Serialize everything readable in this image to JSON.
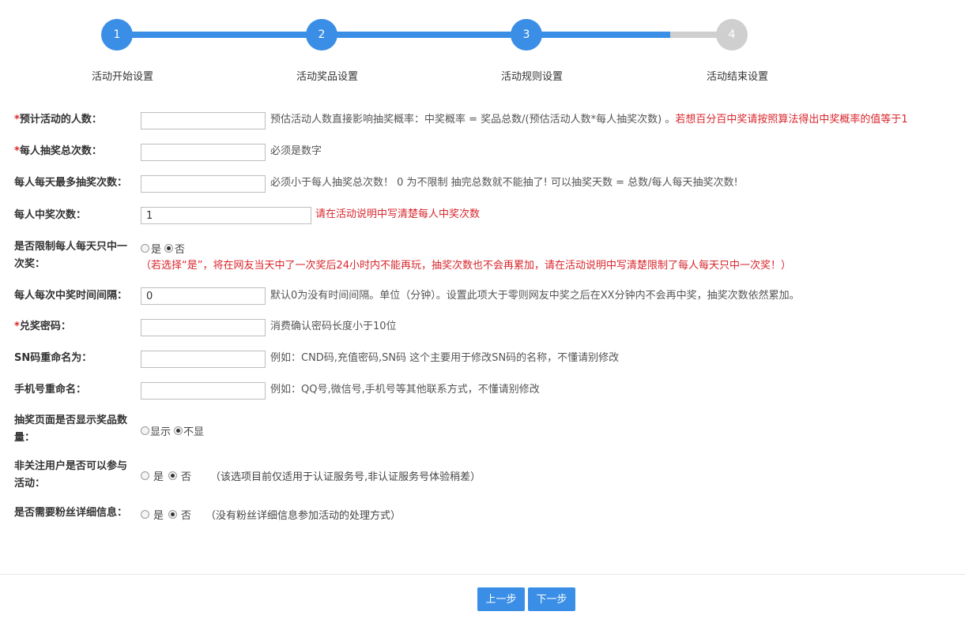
{
  "steps": [
    {
      "num": "1",
      "label": "活动开始设置"
    },
    {
      "num": "2",
      "label": "活动奖品设置"
    },
    {
      "num": "3",
      "label": "活动规则设置"
    },
    {
      "num": "4",
      "label": "活动结束设置"
    }
  ],
  "colors": {
    "accent": "#3a8ee6",
    "inactive": "#cfcfcf",
    "required": "#d9262c"
  },
  "form": {
    "participants": {
      "star": "*",
      "label": "预计活动的人数：",
      "value": "",
      "hint": "预估活动人数直接影响抽奖概率：中奖概率 = 奖品总数/(预估活动人数*每人抽奖次数) 。",
      "hint_red": "若想百分百中奖请按照算法得出中奖概率的值等于1"
    },
    "total_draws": {
      "star": "*",
      "label": "每人抽奖总次数：",
      "value": "",
      "hint": "必须是数字"
    },
    "daily_max": {
      "label": "每人每天最多抽奖次数：",
      "value": "",
      "hint": "必须小于每人抽奖总次数！ 0 为不限制 抽完总数就不能抽了! 可以抽奖天数 = 总数/每人每天抽奖次数!"
    },
    "win_count": {
      "label": "每人中奖次数：",
      "value": "1",
      "hint": "请在活动说明中写清楚每人中奖次数"
    },
    "daily_limit": {
      "label_line1": "是否限制每人每天只中一",
      "label_line2": "次奖：",
      "yes": "是",
      "no": "否",
      "note": "（若选择“是”，将在网友当天中了一次奖后24小时内不能再玩，抽奖次数也不会再累加，请在活动说明中写清楚限制了每人每天只中一次奖！）"
    },
    "interval": {
      "label": "每人每次中奖时间间隔：",
      "value": "0",
      "hint": "默认0为没有时间间隔。单位（分钟）。设置此项大于零则网友中奖之后在XX分钟内不会再中奖，抽奖次数依然累加。"
    },
    "redeem_pwd": {
      "star": "*",
      "label": "兑奖密码：",
      "value": "",
      "hint": "消费确认密码长度小于10位"
    },
    "sn_rename": {
      "label": "SN码重命名为：",
      "value": "",
      "hint": "例如：CND码,充值密码,SN码 这个主要用于修改SN码的名称，不懂请别修改"
    },
    "phone_rename": {
      "label": "手机号重命名：",
      "value": "",
      "hint": "例如：QQ号,微信号,手机号等其他联系方式，不懂请别修改"
    },
    "show_count": {
      "label_line1": "抽奖页面是否显示奖品数",
      "label_line2": "量：",
      "show": "显示",
      "hide": "不显"
    },
    "non_follower": {
      "label_line1": "非关注用户是否可以参与",
      "label_line2": "活动：",
      "yes": "是",
      "no": "否",
      "note": "（该选项目前仅适用于认证服务号,非认证服务号体验稍差）"
    },
    "fan_info": {
      "label": "是否需要粉丝详细信息：",
      "yes": "是",
      "no": "否",
      "note": "（没有粉丝详细信息参加活动的处理方式）"
    }
  },
  "footer": {
    "prev": "上一步",
    "next": "下一步"
  }
}
